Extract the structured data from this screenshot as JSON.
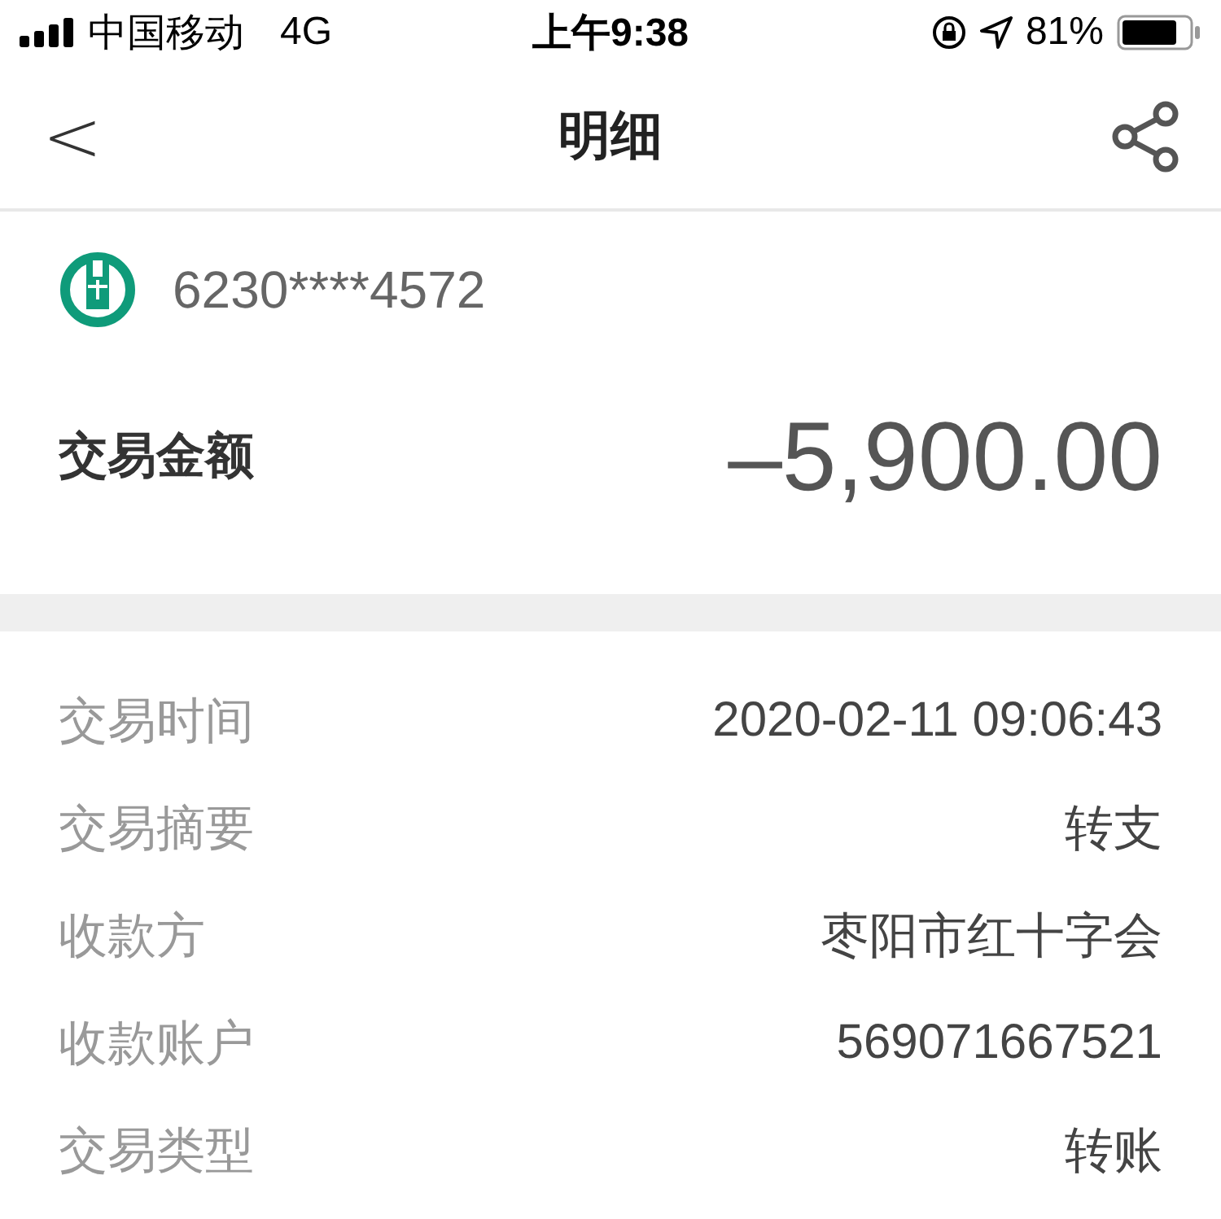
{
  "status_bar": {
    "carrier": "中国移动",
    "network": "4G",
    "time": "上午9:38",
    "battery": "81%"
  },
  "nav": {
    "back": "<",
    "title": "明细"
  },
  "account": {
    "card": "6230****4572"
  },
  "amount": {
    "label": "交易金额",
    "value": "–5,900.00"
  },
  "details": [
    {
      "label": "交易时间",
      "value": "2020-02-11 09:06:43"
    },
    {
      "label": "交易摘要",
      "value": "转支"
    },
    {
      "label": "收款方",
      "value": "枣阳市红十字会"
    },
    {
      "label": "收款账户",
      "value": "569071667521"
    },
    {
      "label": "交易类型",
      "value": "转账"
    }
  ]
}
